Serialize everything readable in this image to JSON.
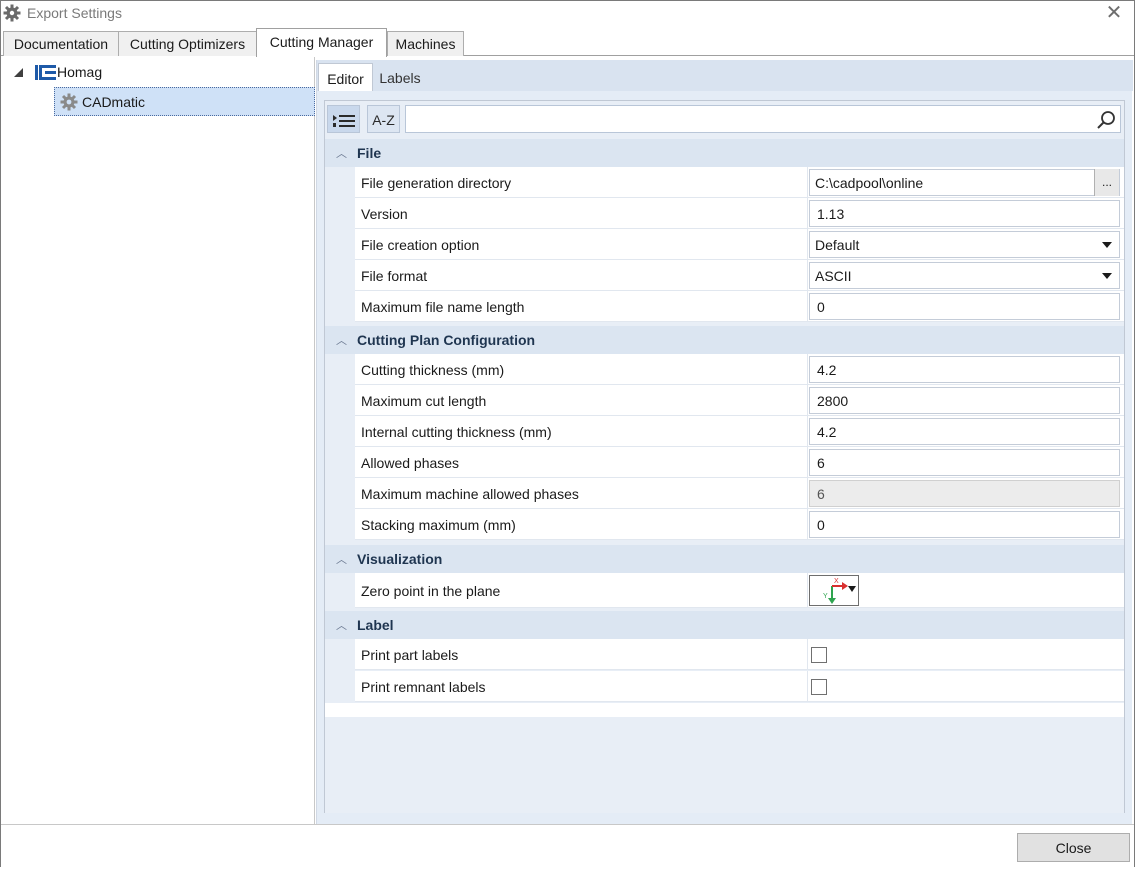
{
  "window": {
    "title": "Export Settings",
    "close_glyph": "✕"
  },
  "top_tabs": [
    {
      "label": "Documentation"
    },
    {
      "label": "Cutting Optimizers"
    },
    {
      "label": "Cutting Manager"
    },
    {
      "label": "Machines"
    }
  ],
  "active_top_tab": "Cutting Manager",
  "tree": {
    "root": {
      "label": "Homag",
      "icon": "homag-logo-icon",
      "expanded": true
    },
    "child": {
      "label": "CADmatic",
      "icon": "gear-icon",
      "selected": true
    }
  },
  "inner_tabs": [
    {
      "label": "Editor"
    },
    {
      "label": "Labels"
    }
  ],
  "active_inner_tab": "Editor",
  "toolbar": {
    "categorized_icon": "categorized-list-icon",
    "sort_label": "A-Z",
    "search_placeholder": "",
    "search_icon": "search-icon"
  },
  "categories": [
    {
      "label": "File",
      "properties": [
        {
          "name": "File generation directory",
          "value": "C:\\cadpool\\online",
          "editor": "browse",
          "browse_label": "..."
        },
        {
          "name": "Version",
          "value": "1.13",
          "editor": "text"
        },
        {
          "name": "File creation option",
          "value": "Default",
          "editor": "dropdown"
        },
        {
          "name": "File format",
          "value": "ASCII",
          "editor": "dropdown"
        },
        {
          "name": "Maximum file name length",
          "value": "0",
          "editor": "text"
        }
      ]
    },
    {
      "label": "Cutting Plan Configuration",
      "properties": [
        {
          "name": "Cutting thickness (mm)",
          "value": "4.2",
          "editor": "text"
        },
        {
          "name": "Maximum cut length",
          "value": "2800",
          "editor": "text"
        },
        {
          "name": "Internal cutting thickness (mm)",
          "value": "4.2",
          "editor": "text"
        },
        {
          "name": "Allowed phases",
          "value": "6",
          "editor": "text"
        },
        {
          "name": "Maximum machine allowed phases",
          "value": "6",
          "editor": "readonly"
        },
        {
          "name": "Stacking maximum (mm)",
          "value": "0",
          "editor": "text"
        }
      ]
    },
    {
      "label": "Visualization",
      "properties": [
        {
          "name": "Zero point in the plane",
          "value": "",
          "editor": "zero-point",
          "axis_x": "X",
          "axis_y": "Y"
        }
      ]
    },
    {
      "label": "Label",
      "properties": [
        {
          "name": "Print part labels",
          "value": false,
          "editor": "checkbox"
        },
        {
          "name": "Print remnant labels",
          "value": false,
          "editor": "checkbox"
        }
      ]
    }
  ],
  "footer": {
    "close_label": "Close"
  },
  "colors": {
    "accent": "#cfe1f7",
    "category_bg": "#dbe5f1",
    "panel_bg": "#e4ecf6"
  }
}
